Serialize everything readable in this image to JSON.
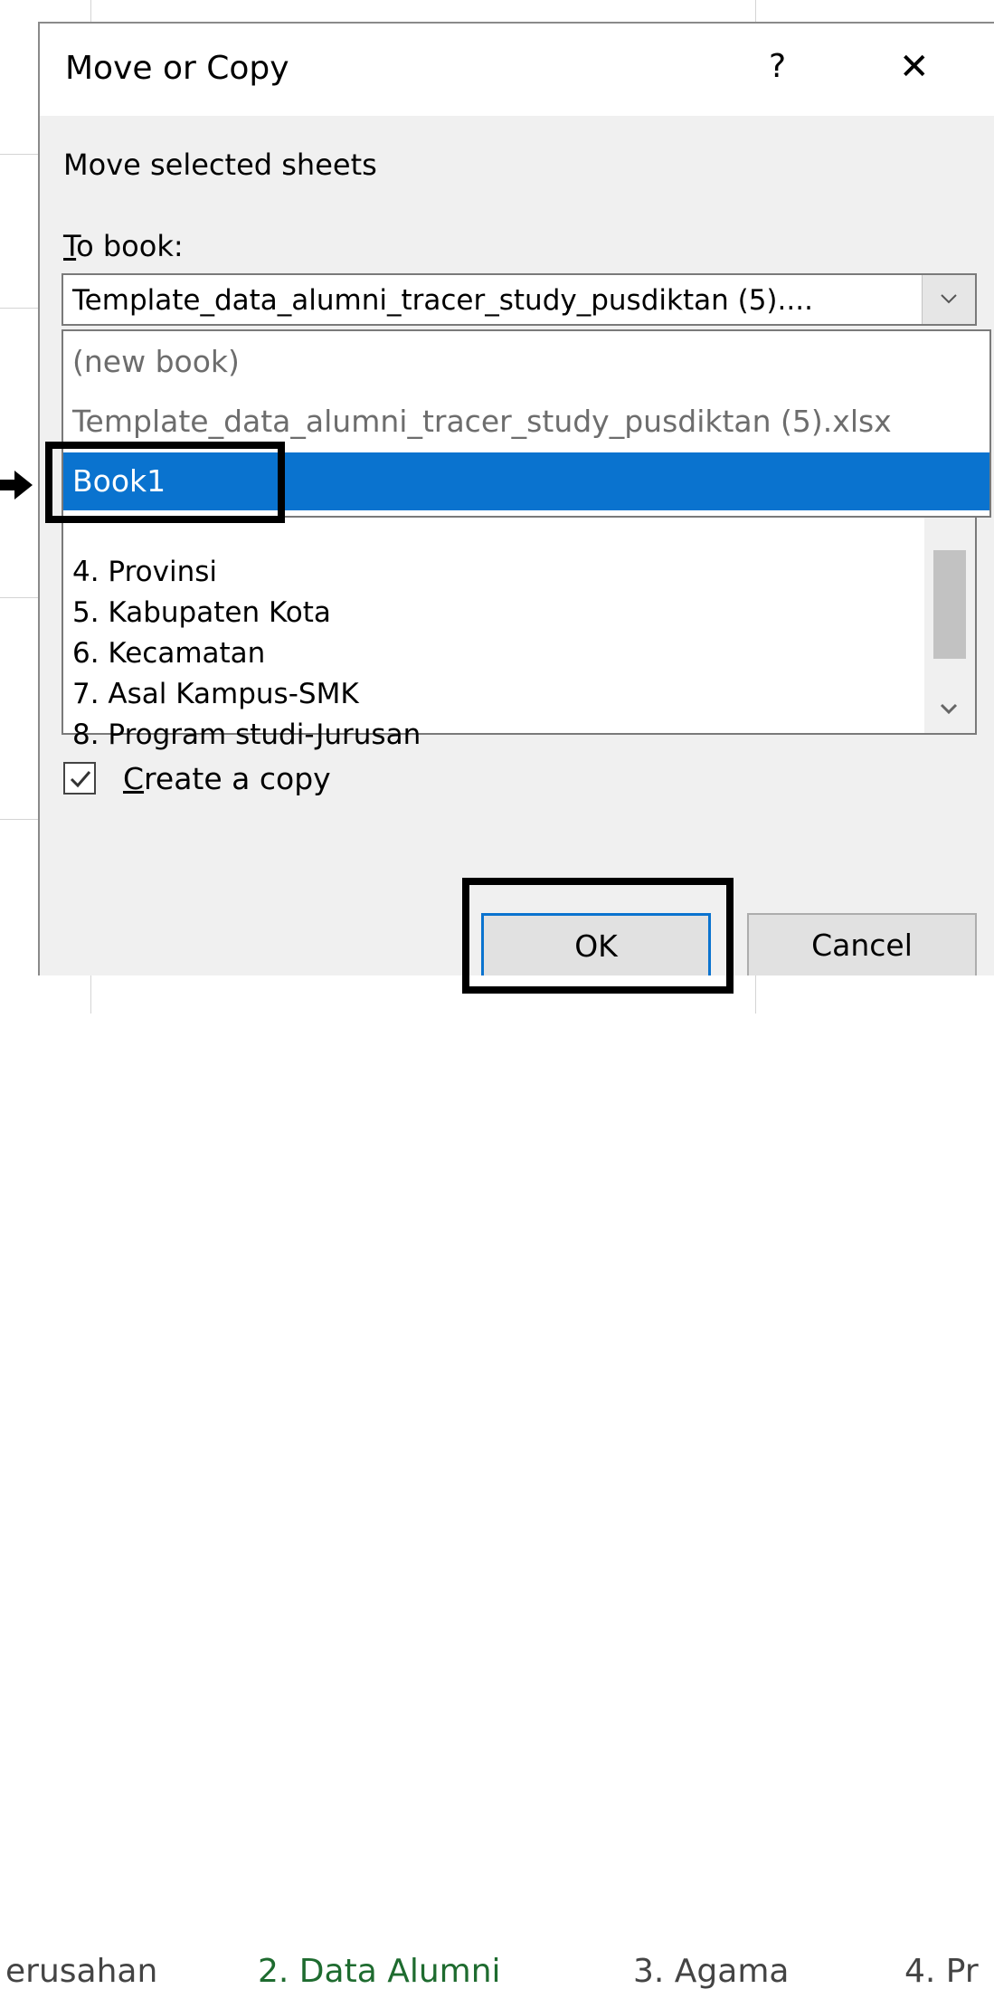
{
  "background": {
    "tabs": [
      "erusahan",
      "2. Data Alumni",
      "3. Agama",
      "4. Pr"
    ]
  },
  "dialog": {
    "title": "Move or Copy",
    "help_label": "?",
    "close_label": "✕",
    "operation_label": "Move selected sheets",
    "to_book": {
      "label_accesskey": "T",
      "label_rest": "o book:",
      "value": "Template_data_alumni_tracer_study_pusdiktan (5)....",
      "options": [
        "(new book)",
        "Template_data_alumni_tracer_study_pusdiktan (5).xlsx",
        "Book1"
      ],
      "selected": "Book1"
    },
    "before_sheet_items": [
      "4. Provinsi",
      "5. Kabupaten Kota",
      "6. Kecamatan",
      "7. Asal Kampus-SMK",
      "8. Program studi-Jurusan"
    ],
    "create_copy": {
      "checked": true,
      "label_accesskey": "C",
      "label_rest": "reate a copy"
    },
    "ok_label": "OK",
    "cancel_label": "Cancel"
  },
  "colors": {
    "accent": "#0a73cf",
    "highlight_box": "#000000"
  }
}
